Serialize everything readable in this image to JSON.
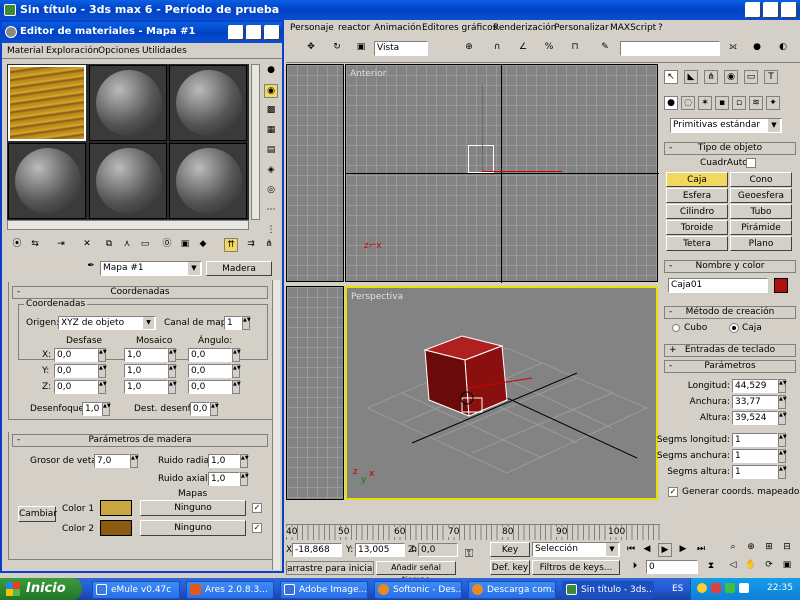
{
  "main": {
    "title": "Sin título - 3ds max 6 - Período de prueba",
    "menu": [
      "Personaje",
      "reactor",
      "Animación",
      "Editores gráficos",
      "Renderización",
      "Personalizar",
      "MAXScript",
      "?"
    ],
    "view_select": "Vista"
  },
  "material_editor": {
    "title": "Editor de materiales - Mapa #1",
    "menu": [
      "Material",
      "Exploración",
      "Opciones",
      "Utilidades"
    ],
    "map_name": "Mapa #1",
    "map_type": "Madera",
    "coords": {
      "rollout": "Coordenadas",
      "group": "Coordenadas",
      "origin_label": "Origen:",
      "origin_value": "XYZ de objeto",
      "channel_label": "Canal de mapa:",
      "channel_value": "1",
      "col_offset": "Desfase",
      "col_tiling": "Mosaico",
      "col_angle": "Ángulo:",
      "rows": [
        {
          "axis": "X:",
          "offset": "0,0",
          "tiling": "1,0",
          "angle": "0,0"
        },
        {
          "axis": "Y:",
          "offset": "0,0",
          "tiling": "1,0",
          "angle": "0,0"
        },
        {
          "axis": "Z:",
          "offset": "0,0",
          "tiling": "1,0",
          "angle": "0,0"
        }
      ],
      "blur_label": "Desenfoque:",
      "blur_value": "1,0",
      "blur_off_label": "Dest. desenf.:",
      "blur_off_value": "0,0"
    },
    "wood": {
      "rollout": "Parámetros de madera",
      "grain_label": "Grosor de veta:",
      "grain_value": "7,0",
      "radial_label": "Ruido radial:",
      "radial_value": "1,0",
      "axial_label": "Ruido axial:",
      "axial_value": "1,0",
      "maps_label": "Mapas",
      "swap": "Cambiar",
      "color1_label": "Color 1",
      "color2_label": "Color 2",
      "color1": "#c8a640",
      "color2": "#8a5a10",
      "none1": "Ninguno",
      "none2": "Ninguno"
    }
  },
  "viewports": {
    "front": "Anterior",
    "persp": "Perspectiva"
  },
  "command_panel": {
    "dropdown": "Primitivas estándar",
    "object_type": {
      "rollout": "Tipo de objeto",
      "autogrid": "CuadrAuto",
      "buttons": [
        "Caja",
        "Cono",
        "Esfera",
        "Geoesfera",
        "Cilindro",
        "Tubo",
        "Toroide",
        "Pirámide",
        "Tetera",
        "Plano"
      ]
    },
    "name_color": {
      "rollout": "Nombre y color",
      "name": "Caja01",
      "color": "#b01010"
    },
    "creation": {
      "rollout": "Método de creación",
      "opt1": "Cubo",
      "opt2": "Caja"
    },
    "keyboard": "Entradas de teclado",
    "params": {
      "rollout": "Parámetros",
      "length_label": "Longitud:",
      "length": "44,529",
      "width_label": "Anchura:",
      "width": "33,77",
      "height_label": "Altura:",
      "height": "39,524",
      "segl_label": "Segms longitud:",
      "segl": "1",
      "segw_label": "Segms anchura:",
      "segw": "1",
      "segh_label": "Segms altura:",
      "segh": "1",
      "genmap": "Generar coords. mapeado"
    }
  },
  "bottom": {
    "ticks": [
      "40",
      "50",
      "60",
      "70",
      "80",
      "90",
      "100"
    ],
    "x_label": "X:",
    "x": "-18,868",
    "y_label": "Y:",
    "y": "13,005",
    "z_label": "Z:",
    "z": "0,0",
    "prompt": "arrastre para iniciar el p",
    "add_time": "Añadir señal tiempo",
    "key_auto": "Key auto",
    "selection": "Selección",
    "def_key": "Def. key",
    "key_filters": "Filtros de keys...",
    "frame": "0"
  },
  "taskbar": {
    "start": "Inicio",
    "tasks": [
      "eMule v0.47c",
      "Ares 2.0.8.3...",
      "Adobe Image...",
      "Softonic - Des...",
      "Descarga com...",
      "Sin título - 3ds..."
    ],
    "lang": "ES",
    "clock": "22:35"
  }
}
